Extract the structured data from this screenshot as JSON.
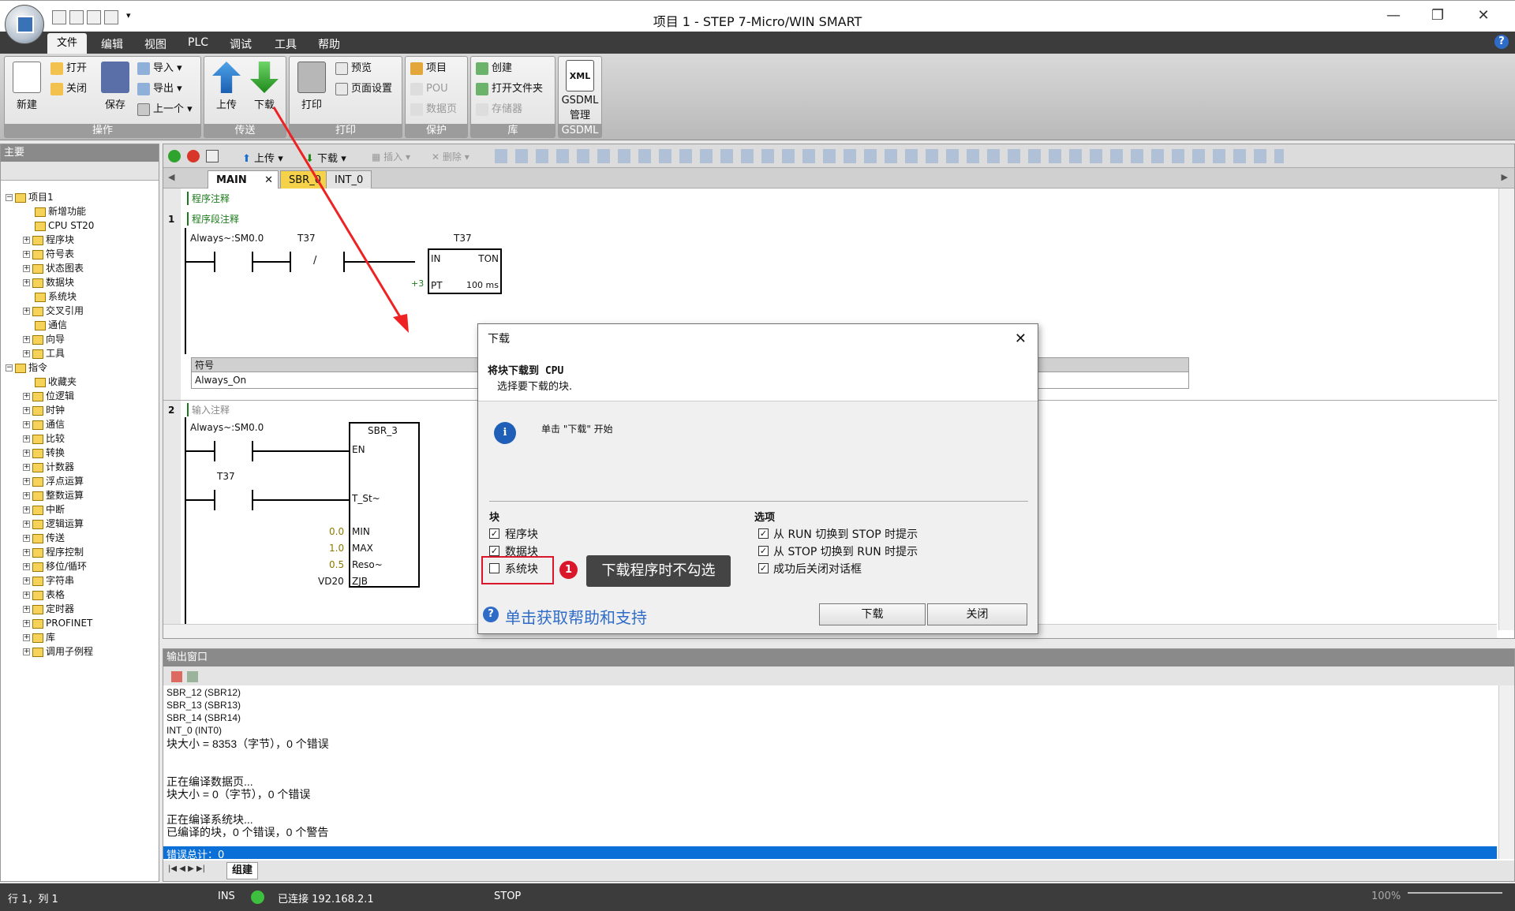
{
  "window": {
    "title": "项目 1 - STEP 7-Micro/WIN SMART",
    "minimize": "—",
    "maximize": "❐",
    "close": "✕"
  },
  "menu": [
    "文件",
    "编辑",
    "视图",
    "PLC",
    "调试",
    "工具",
    "帮助"
  ],
  "ribbon": {
    "groups": [
      {
        "label": "操作",
        "buttons": {
          "new": "新建",
          "open": "打开",
          "close": "关闭",
          "save": "保存",
          "import": "导入",
          "export": "导出",
          "prev": "上一个"
        }
      },
      {
        "label": "传送",
        "buttons": {
          "upload": "上传",
          "download": "下载"
        }
      },
      {
        "label": "打印",
        "buttons": {
          "print": "打印",
          "preview": "预览",
          "page_setup": "页面设置"
        }
      },
      {
        "label": "保护",
        "buttons": {
          "project": "项目",
          "pou": "POU",
          "datapage": "数据页"
        }
      },
      {
        "label": "库",
        "buttons": {
          "create": "创建",
          "open_folder": "打开文件夹",
          "memory": "存储器"
        }
      },
      {
        "label": "GSDML",
        "buttons": {
          "gsdml": "GSDML",
          "manage": "管理"
        }
      }
    ]
  },
  "left_pane": {
    "title": "主要",
    "tree": [
      {
        "label": "项目1",
        "level": 0,
        "exp": "⊟"
      },
      {
        "label": "新增功能",
        "level": 1
      },
      {
        "label": "CPU ST20",
        "level": 1
      },
      {
        "label": "程序块",
        "level": 1,
        "exp": "+"
      },
      {
        "label": "符号表",
        "level": 1,
        "exp": "+"
      },
      {
        "label": "状态图表",
        "level": 1,
        "exp": "+"
      },
      {
        "label": "数据块",
        "level": 1,
        "exp": "+"
      },
      {
        "label": "系统块",
        "level": 1
      },
      {
        "label": "交叉引用",
        "level": 1,
        "exp": "+"
      },
      {
        "label": "通信",
        "level": 1
      },
      {
        "label": "向导",
        "level": 1,
        "exp": "+"
      },
      {
        "label": "工具",
        "level": 1,
        "exp": "+"
      },
      {
        "label": "指令",
        "level": 0,
        "exp": "⊟"
      },
      {
        "label": "收藏夹",
        "level": 1
      },
      {
        "label": "位逻辑",
        "level": 1,
        "exp": "+"
      },
      {
        "label": "时钟",
        "level": 1,
        "exp": "+"
      },
      {
        "label": "通信",
        "level": 1,
        "exp": "+"
      },
      {
        "label": "比较",
        "level": 1,
        "exp": "+"
      },
      {
        "label": "转换",
        "level": 1,
        "exp": "+"
      },
      {
        "label": "计数器",
        "level": 1,
        "exp": "+"
      },
      {
        "label": "浮点运算",
        "level": 1,
        "exp": "+"
      },
      {
        "label": "整数运算",
        "level": 1,
        "exp": "+"
      },
      {
        "label": "中断",
        "level": 1,
        "exp": "+"
      },
      {
        "label": "逻辑运算",
        "level": 1,
        "exp": "+"
      },
      {
        "label": "传送",
        "level": 1,
        "exp": "+"
      },
      {
        "label": "程序控制",
        "level": 1,
        "exp": "+"
      },
      {
        "label": "移位/循环",
        "level": 1,
        "exp": "+"
      },
      {
        "label": "字符串",
        "level": 1,
        "exp": "+"
      },
      {
        "label": "表格",
        "level": 1,
        "exp": "+"
      },
      {
        "label": "定时器",
        "level": 1,
        "exp": "+"
      },
      {
        "label": "PROFINET",
        "level": 1,
        "exp": "+"
      },
      {
        "label": "库",
        "level": 1,
        "exp": "+"
      },
      {
        "label": "调用子例程",
        "level": 1,
        "exp": "+"
      }
    ]
  },
  "editor": {
    "toolbar": {
      "upload": "上传",
      "download": "下载",
      "insert": "插入",
      "delete": "删除"
    },
    "tabs": [
      "MAIN",
      "SBR_0",
      "INT_0"
    ],
    "program_comment": "程序注释",
    "net1": {
      "num": "1",
      "comment": "程序段注释",
      "c1": "Always~:SM0.0",
      "c2": "T37",
      "not": "/",
      "timer": "T37",
      "in": "IN",
      "ton": "TON",
      "pt_val": "+3",
      "pt": "PT",
      "ms": "100 ms",
      "sym_hdr": "符号",
      "sym_val": "Always_On"
    },
    "net2": {
      "num": "2",
      "comment": "输入注释",
      "c1": "Always~:SM0.0",
      "c2": "T37",
      "sbr": "SBR_3",
      "en": "EN",
      "tst": "T_St~",
      "min_v": "0.0",
      "min": "MIN",
      "max_v": "1.0",
      "max": "MAX",
      "reso_v": "0.5",
      "reso": "Reso~",
      "zjb_v": "VD20",
      "zjb": "ZJB"
    }
  },
  "output": {
    "title": "输出窗口",
    "lines": [
      "SBR_12 (SBR12)",
      "SBR_13 (SBR13)",
      "SBR_14 (SBR14)",
      "INT_0 (INT0)"
    ],
    "cn_lines": [
      "块大小 = 8353（字节），0 个错误",
      "",
      "正在编译数据页...",
      "块大小 = 0（字节），0 个错误",
      "",
      "正在编译系统块...",
      "已编译的块，0 个错误，0 个警告"
    ],
    "highlight": "错误总计：0",
    "tab": "组建"
  },
  "status": {
    "pos": "行 1，列 1",
    "ins": "INS",
    "conn": "已连接 192.168.2.1",
    "mode": "STOP",
    "zoom": "100%"
  },
  "dialog": {
    "title": "下载",
    "heading": "将块下载到 CPU",
    "sub": "选择要下载的块.",
    "info": "单击 \"下载\" 开始",
    "blocks_title": "块",
    "blocks": [
      {
        "label": "程序块",
        "checked": true
      },
      {
        "label": "数据块",
        "checked": true
      },
      {
        "label": "系统块",
        "checked": false
      }
    ],
    "options_title": "选项",
    "options": [
      {
        "label": "从 RUN 切换到 STOP 时提示",
        "checked": true
      },
      {
        "label": "从 STOP 切换到 RUN 时提示",
        "checked": true
      },
      {
        "label": "成功后关闭对话框",
        "checked": true
      }
    ],
    "help": "单击获取帮助和支持",
    "download_btn": "下载",
    "close_btn": "关闭"
  },
  "annotation": {
    "num": "1",
    "text": "下载程序时不勾选"
  },
  "colors": {
    "accent": "#2f6cc8",
    "annotation_red": "#d9162a",
    "highlight": "#0a6fd6"
  }
}
